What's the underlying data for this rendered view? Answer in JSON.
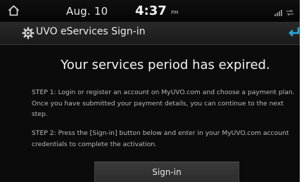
{
  "status_bar": {
    "home_icon": "home-icon",
    "date": "Aug. 10",
    "time": "4:37",
    "ampm": "PM",
    "status_icons": [
      "signal-icon",
      "connection-icon"
    ]
  },
  "title_bar": {
    "settings_icon": "gear-icon",
    "title": "UVO eServices Sign-in",
    "back_icon": "back-arrow-icon"
  },
  "main": {
    "headline": "Your services period has expired.",
    "step1": "STEP 1: Login or register an account on MyUVO.com and choose a payment plan. Once you have submitted your payment details, you can continue to the next step.",
    "step2": "STEP 2: Press the [Sign-in] button below and enter in your MyUVO.com account credentials to complete the activation.",
    "signin_label": "Sign-in"
  },
  "colors": {
    "background": "#0b0b0b",
    "text_primary": "#f4f4f4",
    "text_secondary": "#b9b9b9",
    "back_arrow": "#2aa8e0"
  }
}
